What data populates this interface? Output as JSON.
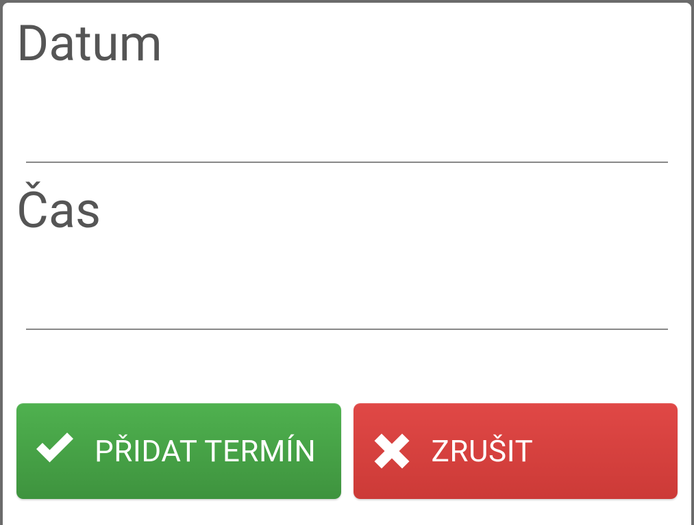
{
  "form": {
    "date_label": "Datum",
    "date_value": "",
    "time_label": "Čas",
    "time_value": ""
  },
  "buttons": {
    "submit_label": "PŘIDAT TERMÍN",
    "cancel_label": "ZRUŠIT"
  },
  "colors": {
    "green": "#449d44",
    "red": "#d9433f"
  },
  "icons": {
    "submit": "check-icon",
    "cancel": "close-icon"
  }
}
